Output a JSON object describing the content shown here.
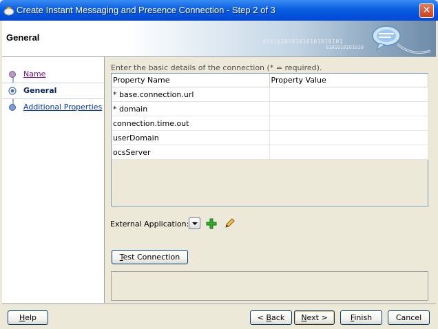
{
  "window": {
    "title": "Create Instant Messaging and Presence Connection - Step 2 of 3",
    "close_glyph": "✕"
  },
  "banner": {
    "title": "General",
    "binary_text": "0101010101010101010101",
    "binary_text2": "0101010101010"
  },
  "nav": {
    "items": [
      {
        "label": "Name",
        "state": "visited"
      },
      {
        "label": "General",
        "state": "current"
      },
      {
        "label": "Additional Properties",
        "state": "link"
      }
    ]
  },
  "main": {
    "instructions": "Enter the basic details of the connection (* = required).",
    "table": {
      "columns": [
        "Property Name",
        "Property Value"
      ],
      "rows": [
        {
          "name": "* base.connection.url",
          "value": ""
        },
        {
          "name": "* domain",
          "value": ""
        },
        {
          "name": "connection.time.out",
          "value": ""
        },
        {
          "name": "userDomain",
          "value": ""
        },
        {
          "name": "ocsServer",
          "value": ""
        }
      ]
    },
    "external_application_label": "External Application:",
    "test_connection": {
      "label_pre": "",
      "label_u": "T",
      "label_post": "est Connection"
    }
  },
  "footer": {
    "help": {
      "pre": "",
      "u": "H",
      "post": "elp"
    },
    "back": {
      "pre": "< ",
      "u": "B",
      "post": "ack"
    },
    "next": {
      "pre": "",
      "u": "N",
      "post": "ext >"
    },
    "finish": {
      "pre": "",
      "u": "F",
      "post": "inish"
    },
    "cancel": {
      "pre": "",
      "u": "",
      "post": "Cancel"
    }
  },
  "colors": {
    "titlebar": "#0a5fe0",
    "visited_link": "#7b0b8a",
    "link": "#0033cc",
    "current_step": "#0a246a",
    "add_icon": "#22a022"
  },
  "icons": [
    "app-icon",
    "close-icon",
    "chat-connection-icon",
    "step-dot-icon",
    "dropdown-arrow-icon",
    "add-icon",
    "edit-pencil-icon"
  ]
}
